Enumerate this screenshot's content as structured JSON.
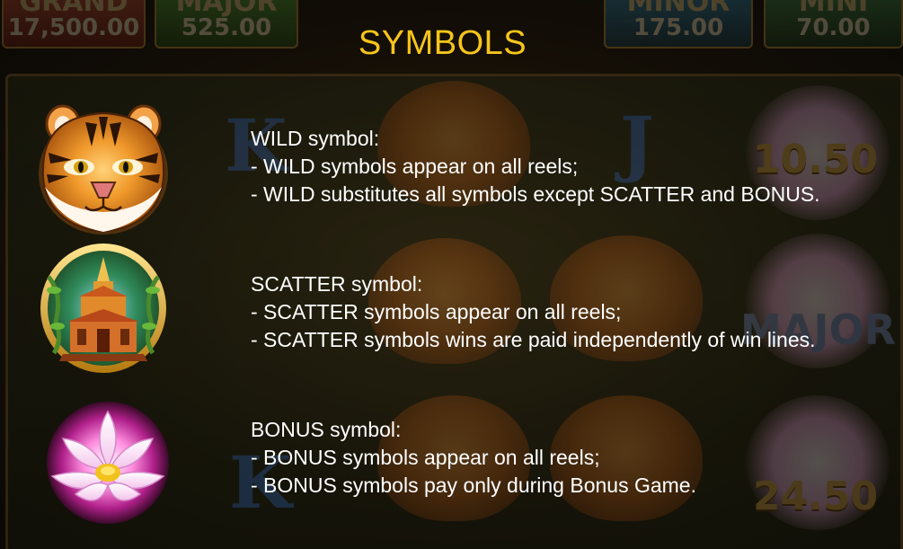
{
  "background": {
    "jackpots": [
      {
        "label": "GRAND",
        "value": "17,500.00",
        "color": "#b23a2a"
      },
      {
        "label": "MAJOR",
        "value": "525.00",
        "color": "#3b8a2a"
      },
      {
        "label": "MINOR",
        "value": "175.00",
        "color": "#1d6a8a"
      },
      {
        "label": "MINI",
        "value": "70.00",
        "color": "#2f6e3a"
      }
    ],
    "reel_letters": [
      "K",
      "J",
      "K"
    ],
    "reel_values": [
      "10.50",
      "24.50"
    ],
    "reel_major": "MAJOR"
  },
  "paytable": {
    "title": "SYMBOLS",
    "title_color": "#f7c51b",
    "symbols": [
      {
        "icon": "tiger-icon",
        "heading": "WILD symbol:",
        "lines": [
          "- WILD symbols appear on all reels;",
          "- WILD substitutes all symbols except SCATTER and BONUS."
        ]
      },
      {
        "icon": "temple-icon",
        "heading": "SCATTER symbol:",
        "lines": [
          "- SCATTER symbols appear on all reels;",
          "- SCATTER symbols wins are paid independently of win lines."
        ]
      },
      {
        "icon": "lotus-icon",
        "heading": "BONUS symbol:",
        "lines": [
          "- BONUS symbols appear on all reels;",
          "- BONUS symbols pay only during Bonus Game."
        ]
      }
    ]
  }
}
